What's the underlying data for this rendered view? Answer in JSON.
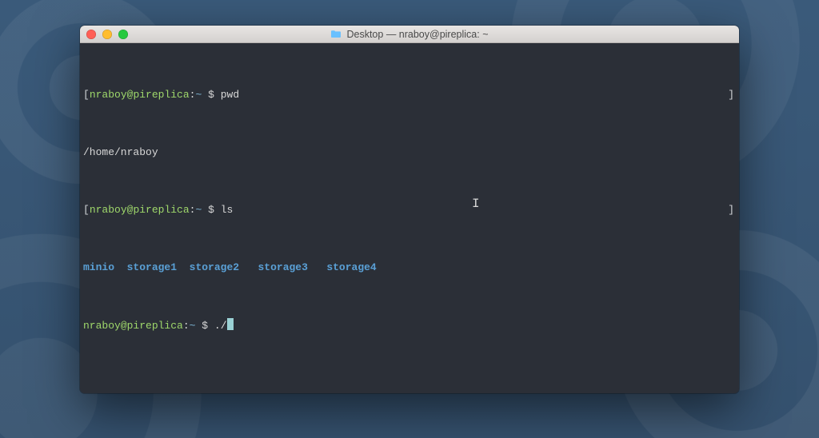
{
  "window": {
    "title": "Desktop — nraboy@pireplica: ~"
  },
  "prompt": {
    "user": "nraboy",
    "at": "@",
    "host": "pireplica",
    "colon": ":",
    "path": "~",
    "symbol": "$"
  },
  "lines": {
    "l1_cmd": "pwd",
    "l2_out": "/home/nraboy",
    "l3_cmd": "ls",
    "ls_items": {
      "i0": "minio",
      "i1": "storage1",
      "i2": "storage2",
      "i3": "storage3",
      "i4": "storage4"
    },
    "l5_cmd": "./"
  },
  "brackets": {
    "open": "[",
    "close": "]"
  },
  "sep": {
    "two": "  ",
    "three": "   "
  }
}
